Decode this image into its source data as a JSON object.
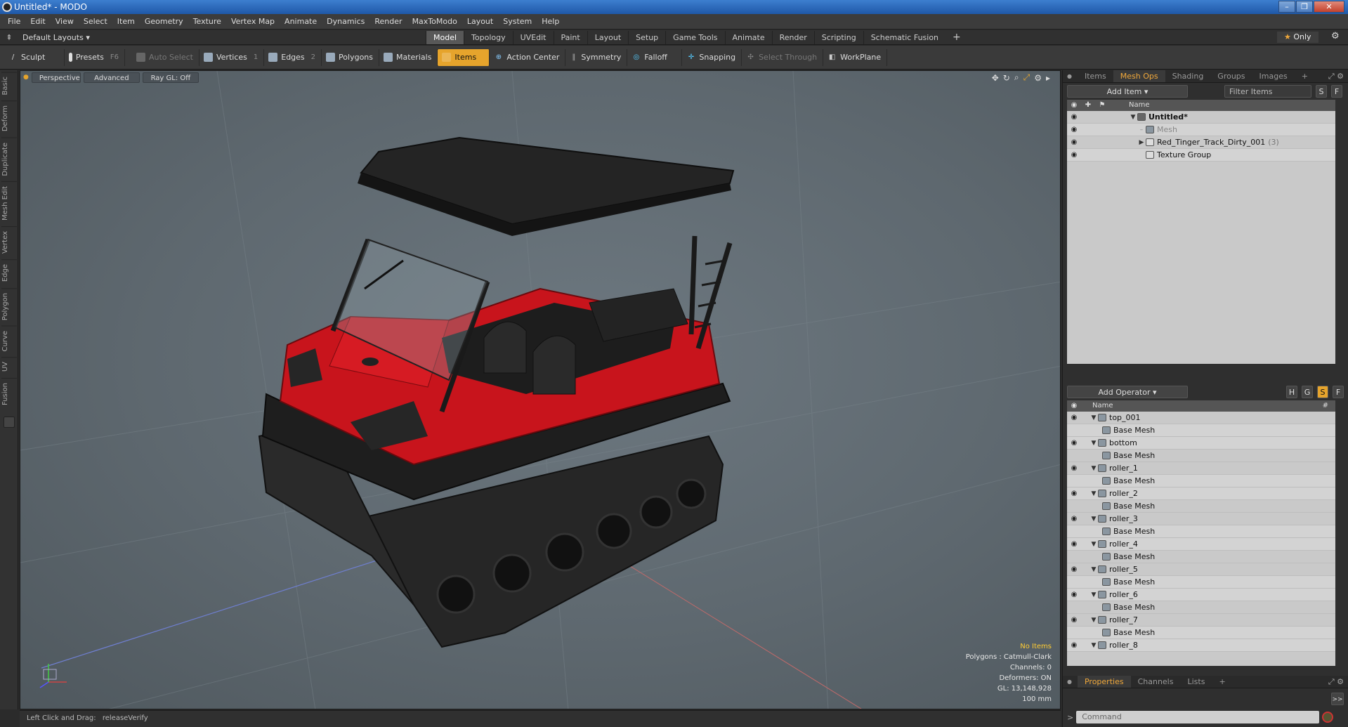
{
  "window": {
    "title": "Untitled* - MODO",
    "controls": [
      "–",
      "❐",
      "✕"
    ]
  },
  "menu": [
    "File",
    "Edit",
    "View",
    "Select",
    "Item",
    "Geometry",
    "Texture",
    "Vertex Map",
    "Animate",
    "Dynamics",
    "Render",
    "MaxToModo",
    "Layout",
    "System",
    "Help"
  ],
  "layout_selector": "Default Layouts",
  "layout_tabs": [
    "Model",
    "Topology",
    "UVEdit",
    "Paint",
    "Layout",
    "Setup",
    "Game Tools",
    "Animate",
    "Render",
    "Scripting",
    "Schematic Fusion"
  ],
  "layout_tab_add": "+",
  "only_label": "Only",
  "toolbar": {
    "sculpt": "Sculpt",
    "presets": "Presets",
    "presets_key": "F6",
    "auto_select": "Auto Select",
    "vertices": "Vertices",
    "vertices_count": "1",
    "edges": "Edges",
    "edges_count": "2",
    "polygons": "Polygons",
    "materials": "Materials",
    "items": "Items",
    "action_center": "Action Center",
    "symmetry": "Symmetry",
    "falloff": "Falloff",
    "snapping": "Snapping",
    "select_through": "Select Through",
    "workplane": "WorkPlane"
  },
  "left_tabs": [
    "Basic",
    "Deform",
    "Duplicate",
    "Mesh Edit",
    "Vertex",
    "Edge",
    "Polygon",
    "Curve",
    "UV",
    "Fusion"
  ],
  "viewport": {
    "perspective": "Perspective",
    "advanced": "Advanced",
    "raygl": "Ray GL: Off",
    "info": {
      "no_items": "No Items",
      "polygons": "Polygons : Catmull-Clark",
      "channels": "Channels: 0",
      "deformers": "Deformers: ON",
      "gl": "GL: 13,148,928",
      "scale": "100 mm"
    }
  },
  "status": {
    "hint": "Left Click and Drag:",
    "command": "releaseVerify"
  },
  "items_panel": {
    "tabs": [
      "Items",
      "Mesh Ops",
      "Shading",
      "Groups",
      "Images"
    ],
    "add": "+",
    "add_item": "Add Item",
    "filter": "Filter Items",
    "s": "S",
    "f": "F",
    "col_name": "Name",
    "scene": "Untitled*",
    "mesh": "Mesh",
    "group_name": "Red_Tinger_Track_Dirty_001",
    "group_count": "(3)",
    "texture_group": "Texture Group"
  },
  "meshops_panel": {
    "add_operator": "Add Operator",
    "flags": [
      "H",
      "G",
      "S",
      "F"
    ],
    "col_name": "Name",
    "col_hash": "#",
    "base_label": "Base Mesh",
    "items": [
      "top_001",
      "bottom",
      "roller_1",
      "roller_2",
      "roller_3",
      "roller_4",
      "roller_5",
      "roller_6",
      "roller_7",
      "roller_8"
    ]
  },
  "bottom_panel": {
    "tabs": [
      "Properties",
      "Channels",
      "Lists"
    ],
    "add": "+",
    "expand": ">>",
    "command_placeholder": "Command"
  },
  "colors": {
    "accent": "#e6a42c",
    "tab_active": "#f0a83a",
    "vehicle_red": "#c8141c",
    "vehicle_black": "#1c1c1c"
  }
}
